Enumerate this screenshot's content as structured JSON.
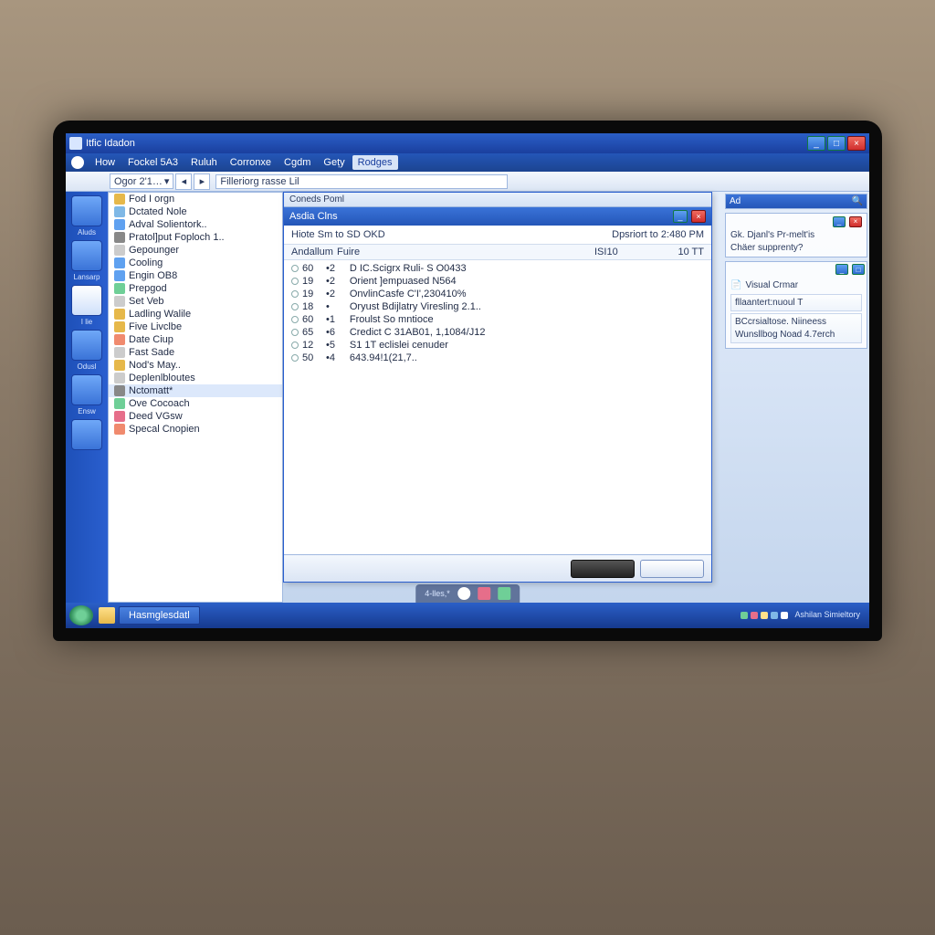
{
  "window": {
    "title": "Itfic Idadon"
  },
  "menu": {
    "icon": "app-icon",
    "items": [
      "How",
      "Fockel 5A3",
      "Ruluh",
      "Corronxe",
      "Cgdm",
      "Gețy",
      "Rodges"
    ],
    "active_index": 6
  },
  "toolbar": {
    "selector_label": "Ogor 2'1…",
    "address_text": "Filleriorg rasse Lil"
  },
  "sidebar_left": [
    {
      "label": "Aluds",
      "active": false
    },
    {
      "label": "Lansarp",
      "active": false
    },
    {
      "label": "I lie",
      "active": true
    },
    {
      "label": "Odusl",
      "active": false
    },
    {
      "label": "Ensw",
      "active": false
    },
    {
      "label": "",
      "active": false
    }
  ],
  "tree": {
    "items": [
      {
        "label": "Fod I orgn",
        "color": "c1"
      },
      {
        "label": "Dctated Nole",
        "color": "c2"
      },
      {
        "label": "Adval Solientork..",
        "color": "c8"
      },
      {
        "label": "Pratol]put Foploch 1..",
        "color": "c7"
      },
      {
        "label": "Gepounger",
        "color": "c9"
      },
      {
        "label": "Cooling",
        "color": "c8"
      },
      {
        "label": "Engin OB8",
        "color": "c8"
      },
      {
        "label": "Prepgod",
        "color": "c3"
      },
      {
        "label": "Set Veb",
        "color": "c9"
      },
      {
        "label": "Ladling Walile",
        "color": "c1"
      },
      {
        "label": "Five Livclbe",
        "color": "c1"
      },
      {
        "label": "Date Ciup",
        "color": "c4"
      },
      {
        "label": "Fast Sade",
        "color": "c9"
      },
      {
        "label": "Nod's May..",
        "color": "c1"
      },
      {
        "label": "Deplenlbloutes",
        "color": "c9"
      },
      {
        "label": "Nctomatt*",
        "color": "c7",
        "selected": true
      },
      {
        "label": "Ove Cocoach",
        "color": "c3"
      },
      {
        "label": "Deed VGsw",
        "color": "c6"
      },
      {
        "label": "Specal Cnopien",
        "color": "c4"
      }
    ]
  },
  "popup": {
    "tab_label": "Coneds Poml",
    "title": "Asdia Clns",
    "info_left": "Hiote Sm to SD OKD",
    "info_right": "Dpsriort to 2:480 PM",
    "headers": [
      "Andallum",
      "Fuire",
      "ISI10",
      "10 TT"
    ],
    "rows": [
      {
        "a": "60",
        "b": "2",
        "desc": "D IC.Scigrx Ruli- S O0433"
      },
      {
        "a": "19",
        "b": "2",
        "desc": "Orient ]empuased N564"
      },
      {
        "a": "19",
        "b": "2",
        "desc": "OnvlinCasfe C'I',230410%"
      },
      {
        "a": "18",
        "b": "",
        "desc": "Oryust Bdijlatry Viresling 2.1.."
      },
      {
        "a": "60",
        "b": "1",
        "desc": "Froulst So mntioce"
      },
      {
        "a": "65",
        "b": "6",
        "desc": "Credict C 31AB01, 1,1084/J12"
      },
      {
        "a": "12",
        "b": "5",
        "desc": "S1 1T eclislei cenuder"
      },
      {
        "a": "50",
        "b": "4",
        "desc": "643.94!1(21,7.."
      }
    ]
  },
  "right_pane": {
    "search_hint": "Ad",
    "line1": "Gk. Djanl's Pr-melt'is",
    "line2": "Chäer supprenty?",
    "panel2_title": "Visual Crmar",
    "panel2_item1": "fllaantert:nuoul T",
    "panel2_item2": "BCcrsialtose. Niineess",
    "panel2_item3": "Wunsllbog Noad 4.7erch"
  },
  "taskbar": {
    "task_label": "Hasmglesdatl",
    "tray_label": "Ashilan Simieltory"
  },
  "bottom_dock": {
    "label": "4-lles,*"
  }
}
